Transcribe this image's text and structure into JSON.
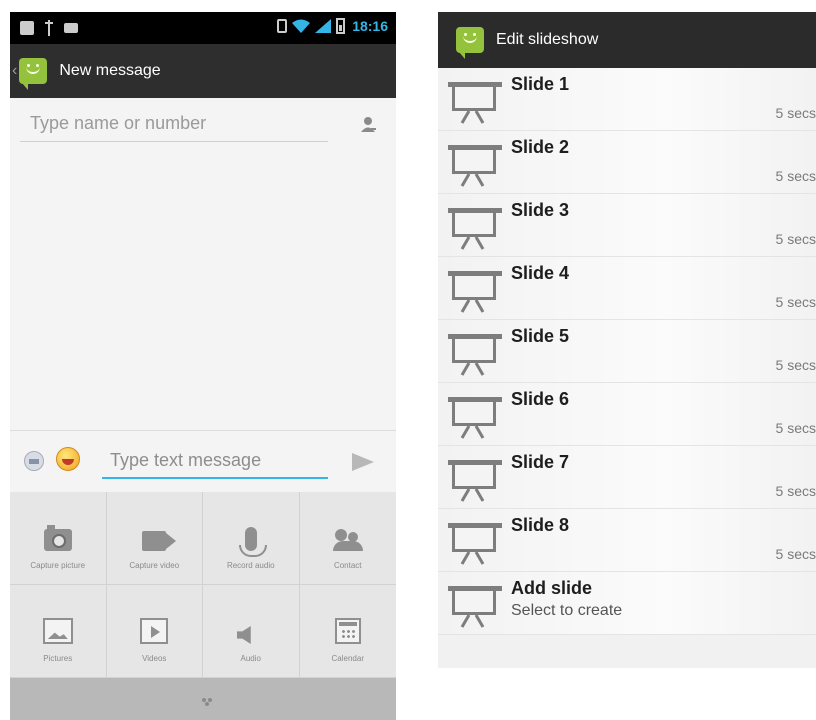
{
  "left": {
    "status": {
      "time": "18:16"
    },
    "header": {
      "title": "New message"
    },
    "recipient": {
      "placeholder": "Type name or number"
    },
    "compose": {
      "placeholder": "Type text message"
    },
    "attachments": [
      {
        "label": "Capture picture",
        "icon": "camera-icon"
      },
      {
        "label": "Capture video",
        "icon": "video-camera-icon"
      },
      {
        "label": "Record audio",
        "icon": "microphone-icon"
      },
      {
        "label": "Contact",
        "icon": "contacts-icon"
      },
      {
        "label": "Pictures",
        "icon": "pictures-icon"
      },
      {
        "label": "Videos",
        "icon": "videos-icon"
      },
      {
        "label": "Audio",
        "icon": "speaker-icon"
      },
      {
        "label": "Calendar",
        "icon": "calendar-icon"
      }
    ]
  },
  "right": {
    "header": {
      "title": "Edit slideshow"
    },
    "slides": [
      {
        "title": "Slide 1",
        "duration": "5 secs"
      },
      {
        "title": "Slide 2",
        "duration": "5 secs"
      },
      {
        "title": "Slide 3",
        "duration": "5 secs"
      },
      {
        "title": "Slide 4",
        "duration": "5 secs"
      },
      {
        "title": "Slide 5",
        "duration": "5 secs"
      },
      {
        "title": "Slide 6",
        "duration": "5 secs"
      },
      {
        "title": "Slide 7",
        "duration": "5 secs"
      },
      {
        "title": "Slide 8",
        "duration": "5 secs"
      }
    ],
    "add": {
      "title": "Add slide",
      "subtitle": "Select to create"
    }
  },
  "colors": {
    "accent": "#33b5e5",
    "app_green": "#94c23d",
    "actionbar": "#2e2e2e"
  }
}
